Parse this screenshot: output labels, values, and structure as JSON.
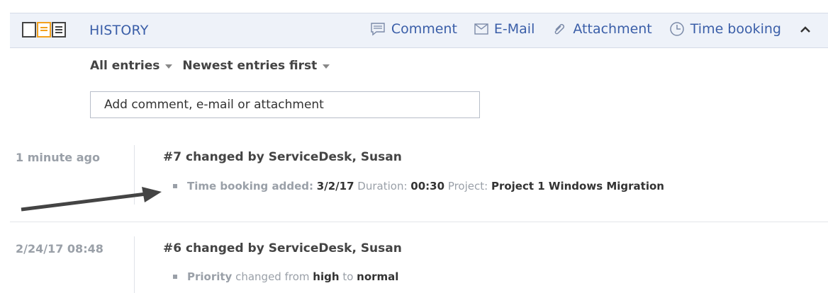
{
  "header": {
    "title": "HISTORY",
    "actions": {
      "comment": "Comment",
      "email": "E-Mail",
      "attachment": "Attachment",
      "time_booking": "Time booking"
    },
    "accent_color": "#3a5ea8",
    "active_layout_color": "#f2a01d"
  },
  "filters": {
    "entries": "All entries",
    "order": "Newest entries first"
  },
  "add_input": {
    "placeholder": "Add comment, e-mail or attachment"
  },
  "entries": [
    {
      "time": "1 minute ago",
      "title": "#7 changed by ServiceDesk, Susan",
      "detail": {
        "label": "Time booking added:",
        "date": "3/2/17",
        "duration_label": "Duration:",
        "duration": "00:30",
        "project_label": "Project:",
        "project": "Project 1 Windows Migration"
      }
    },
    {
      "time": "2/24/17 08:48",
      "title": "#6 changed by ServiceDesk, Susan",
      "detail": {
        "field": "Priority",
        "changed_from": "changed from",
        "old": "high",
        "to": "to",
        "new": "normal"
      }
    }
  ]
}
